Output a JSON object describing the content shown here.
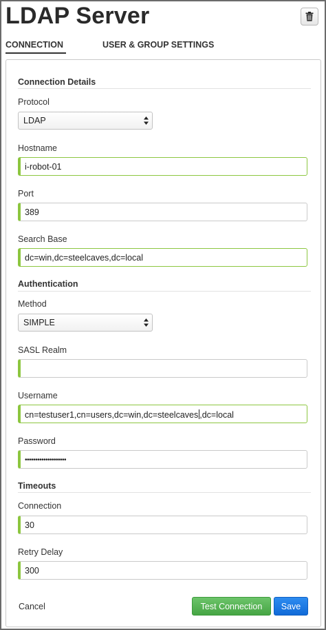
{
  "header": {
    "title": "LDAP Server"
  },
  "tabs": [
    {
      "label": "CONNECTION"
    },
    {
      "label": "USER & GROUP SETTINGS"
    }
  ],
  "sections": {
    "connection_details": "Connection Details",
    "authentication": "Authentication",
    "timeouts": "Timeouts"
  },
  "fields": {
    "protocol": {
      "label": "Protocol",
      "value": "LDAP"
    },
    "hostname": {
      "label": "Hostname",
      "value": "i-robot-01"
    },
    "port": {
      "label": "Port",
      "value": "389"
    },
    "search_base": {
      "label": "Search Base",
      "value": "dc=win,dc=steelcaves,dc=local"
    },
    "method": {
      "label": "Method",
      "value": "SIMPLE"
    },
    "sasl_realm": {
      "label": "SASL Realm",
      "value": ""
    },
    "username": {
      "label": "Username",
      "value_before_caret": "cn=testuser1,cn=users,dc=win,dc=steelcaves",
      "value_after_caret": ",dc=local"
    },
    "password": {
      "label": "Password",
      "value": "••••••••••••••••••••"
    },
    "connection_timeout": {
      "label": "Connection",
      "value": "30"
    },
    "retry_delay": {
      "label": "Retry Delay",
      "value": "300"
    }
  },
  "footer": {
    "cancel": "Cancel",
    "test_connection": "Test Connection",
    "save": "Save"
  },
  "colors": {
    "accent_green": "#8cc63f",
    "test_button": "#46a544",
    "save_button": "#116ad8"
  },
  "icons": {
    "delete": "trash-icon",
    "select": "updown-arrows-icon"
  }
}
